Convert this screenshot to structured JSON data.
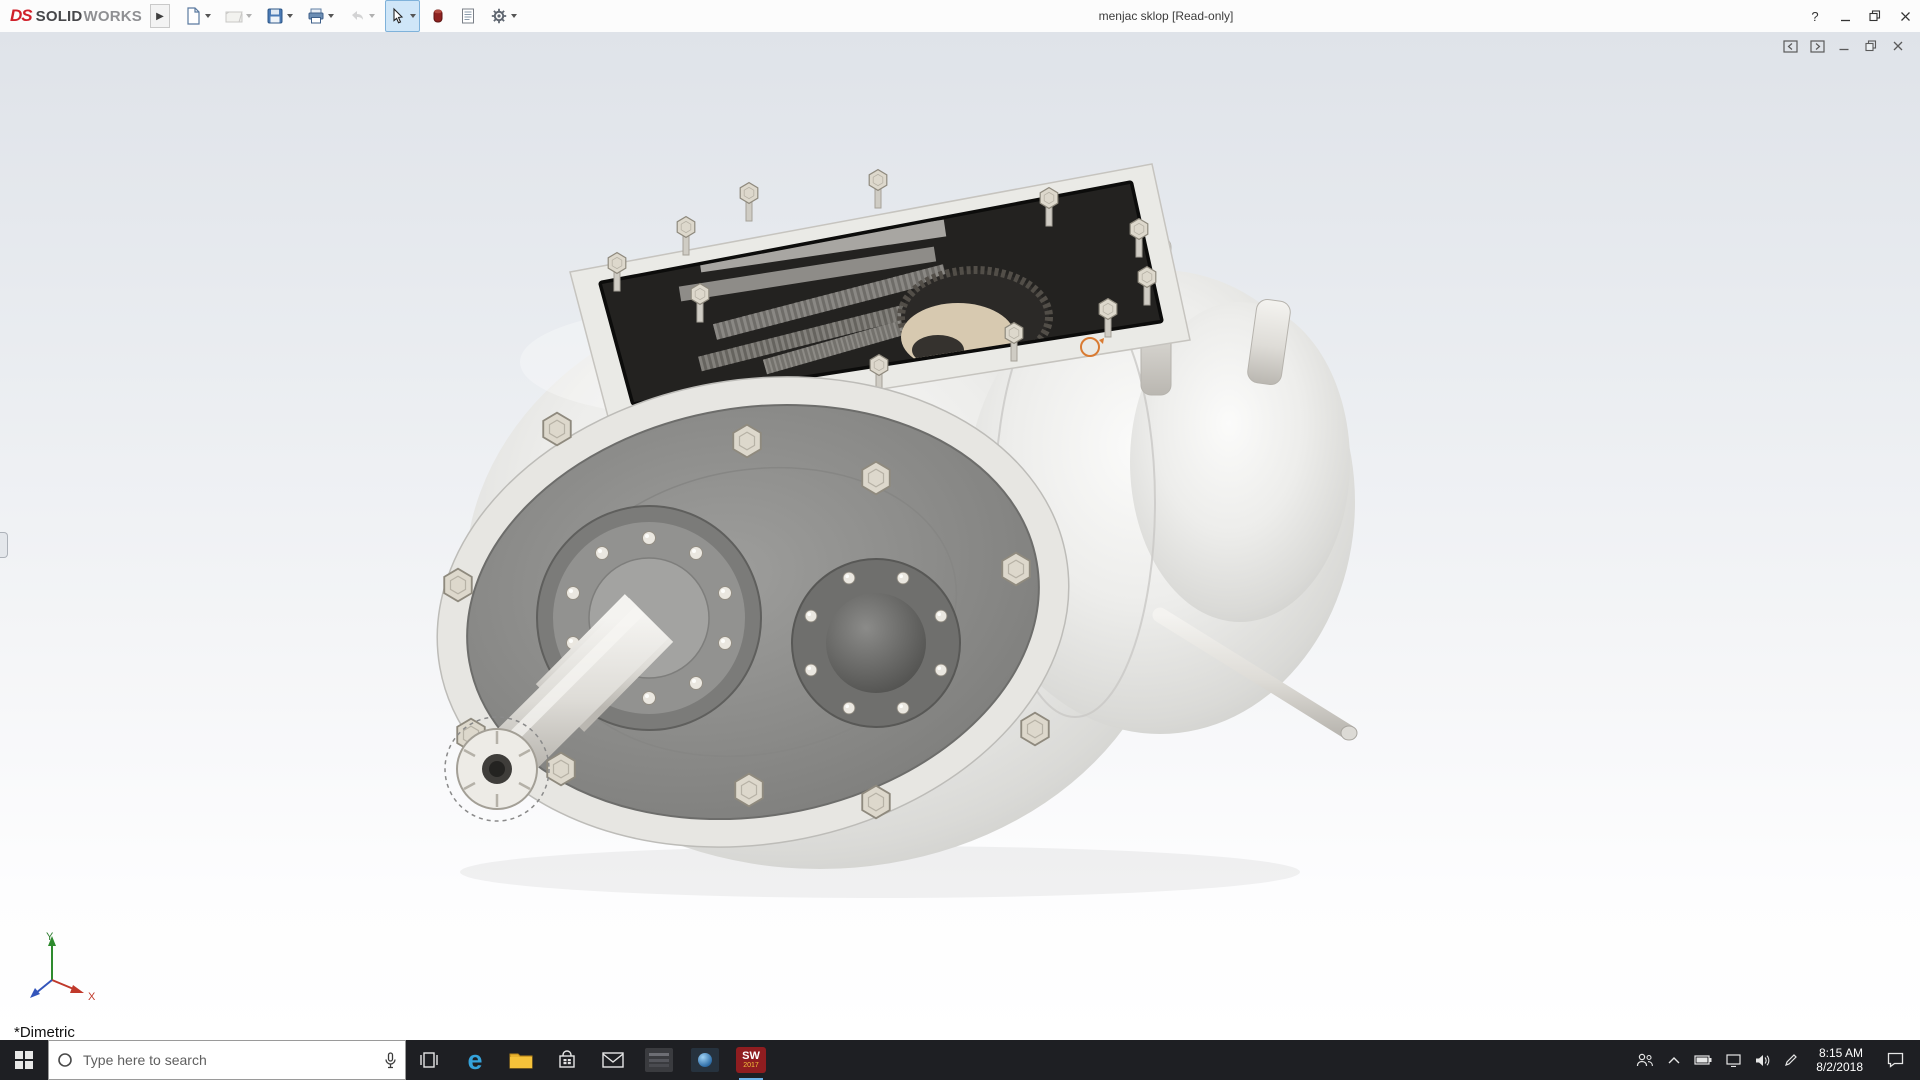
{
  "app": {
    "logo": {
      "mark_text": "DS",
      "name_primary": "SOLID",
      "name_secondary": "WORKS"
    },
    "flyout_glyph": "▶",
    "title": "menjac sklop [Read-only]",
    "window_controls": {
      "help": "?"
    },
    "toolbar_button_names": [
      "new-document",
      "open",
      "save",
      "print",
      "undo",
      "select",
      "appearances",
      "document-properties",
      "options-gear"
    ]
  },
  "document_window": {
    "control_names": [
      "pane-left",
      "pane-right",
      "minimize",
      "restore",
      "close"
    ]
  },
  "viewport": {
    "view_orientation": "*Dimetric",
    "triad": {
      "x_label": "X",
      "y_label": "Y"
    },
    "colors": {
      "background_top": "#dfe3e9",
      "background_bottom": "#ffffff",
      "rotate_cursor": "#d97b33",
      "model_body": "#ececea",
      "model_face": "#8f8f8d"
    }
  },
  "taskbar": {
    "colors": {
      "background": "#1e1f23",
      "open_app_underline": "#6cb2e8"
    },
    "search": {
      "placeholder": "Type here to search"
    },
    "pinned_app_names": [
      "task-view",
      "edge",
      "file-explorer",
      "store",
      "mail",
      "pinned-app-1",
      "pinned-app-2",
      "solidworks"
    ],
    "edge_glyph": "e",
    "solidworks_badge": {
      "label": "SW",
      "year": "2017"
    },
    "tray_icon_names": [
      "people",
      "chevron-up",
      "battery",
      "display",
      "volume",
      "pen"
    ],
    "clock": {
      "time": "8:15 AM",
      "date": "8/2/2018"
    }
  }
}
